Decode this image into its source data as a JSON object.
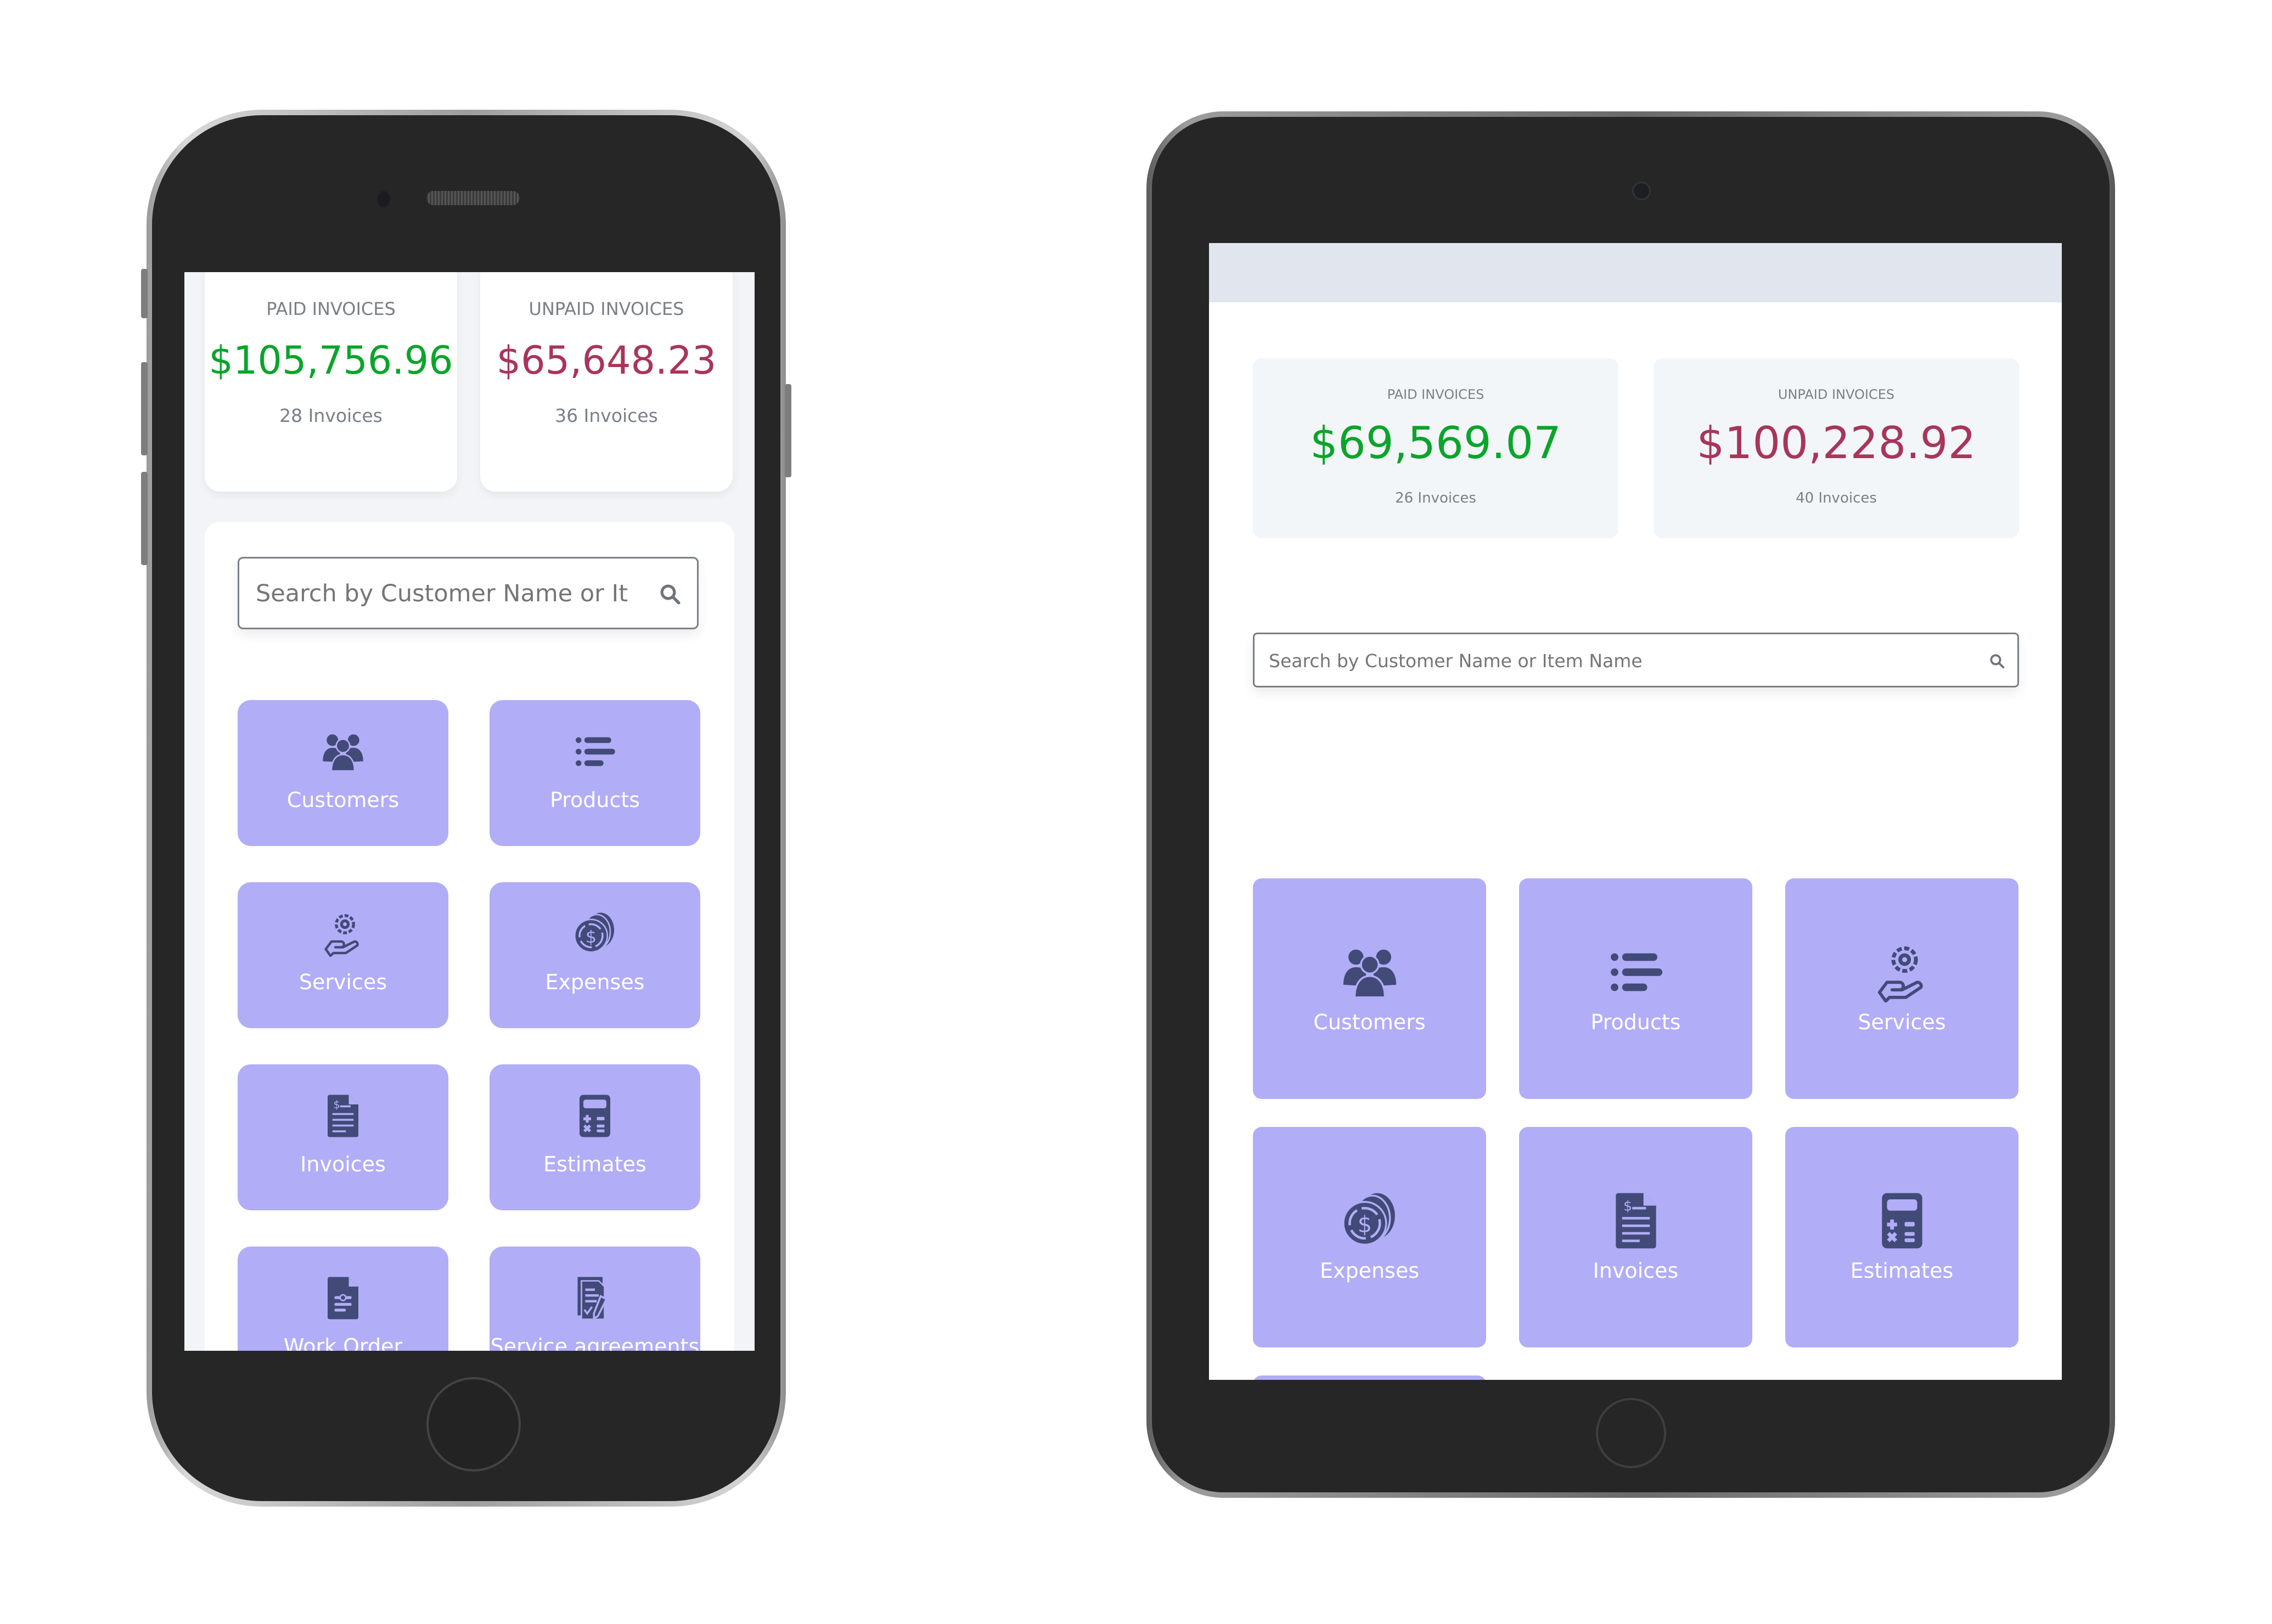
{
  "colors": {
    "paid": "#0aa52a",
    "unpaid": "#a8355a",
    "tile_bg": "#b1adf7",
    "icon": "#424a78"
  },
  "phone": {
    "stats": {
      "paid": {
        "label": "PAID INVOICES",
        "amount": "$105,756.96",
        "count": "28 Invoices"
      },
      "unpaid": {
        "label": "UNPAID INVOICES",
        "amount": "$65,648.23",
        "count": "36 Invoices"
      }
    },
    "search": {
      "placeholder": "Search by Customer Name or Item Name",
      "icon": "search-icon"
    },
    "tiles": [
      {
        "label": "Customers",
        "icon": "users-icon"
      },
      {
        "label": "Products",
        "icon": "list-icon"
      },
      {
        "label": "Services",
        "icon": "service-hand-gear-icon"
      },
      {
        "label": "Expenses",
        "icon": "coins-icon"
      },
      {
        "label": "Invoices",
        "icon": "invoice-icon"
      },
      {
        "label": "Estimates",
        "icon": "calculator-icon"
      },
      {
        "label": "Work Order",
        "icon": "work-order-icon"
      },
      {
        "label": "Service agreements",
        "icon": "agreement-sign-icon"
      }
    ]
  },
  "tablet": {
    "stats": {
      "paid": {
        "label": "PAID INVOICES",
        "amount": "$69,569.07",
        "count": "26 Invoices"
      },
      "unpaid": {
        "label": "UNPAID INVOICES",
        "amount": "$100,228.92",
        "count": "40 Invoices"
      }
    },
    "search": {
      "placeholder": "Search by Customer Name or Item Name",
      "icon": "search-icon"
    },
    "tiles": [
      {
        "label": "Customers",
        "icon": "users-icon"
      },
      {
        "label": "Products",
        "icon": "list-icon"
      },
      {
        "label": "Services",
        "icon": "service-hand-gear-icon"
      },
      {
        "label": "Expenses",
        "icon": "coins-icon"
      },
      {
        "label": "Invoices",
        "icon": "invoice-icon"
      },
      {
        "label": "Estimates",
        "icon": "calculator-icon"
      },
      {
        "label": "",
        "icon": "gear-icon"
      }
    ]
  }
}
